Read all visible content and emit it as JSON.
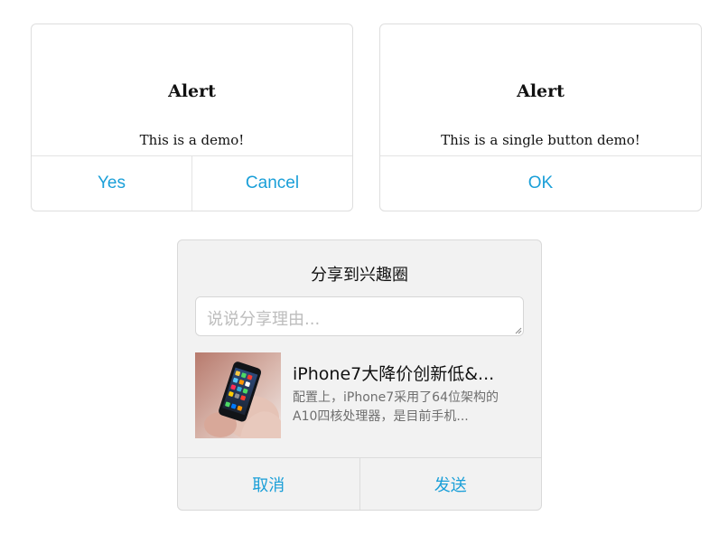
{
  "alert_double": {
    "title": "Alert",
    "message": "This is a demo!",
    "buttons": [
      "Yes",
      "Cancel"
    ]
  },
  "alert_single": {
    "title": "Alert",
    "message": "This is a single button demo!",
    "button": "OK"
  },
  "share_dialog": {
    "title": "分享到兴趣圈",
    "input_placeholder": "说说分享理由...",
    "input_value": "",
    "item": {
      "title": "iPhone7大降价创新低&...",
      "description": "配置上，iPhone7采用了64位架构的A10四核处理器，是目前手机..."
    },
    "buttons": [
      "取消",
      "发送"
    ]
  },
  "colors": {
    "accent": "#1a9fd8",
    "border": "#dedede",
    "dialog_bg": "#f2f2f2"
  }
}
